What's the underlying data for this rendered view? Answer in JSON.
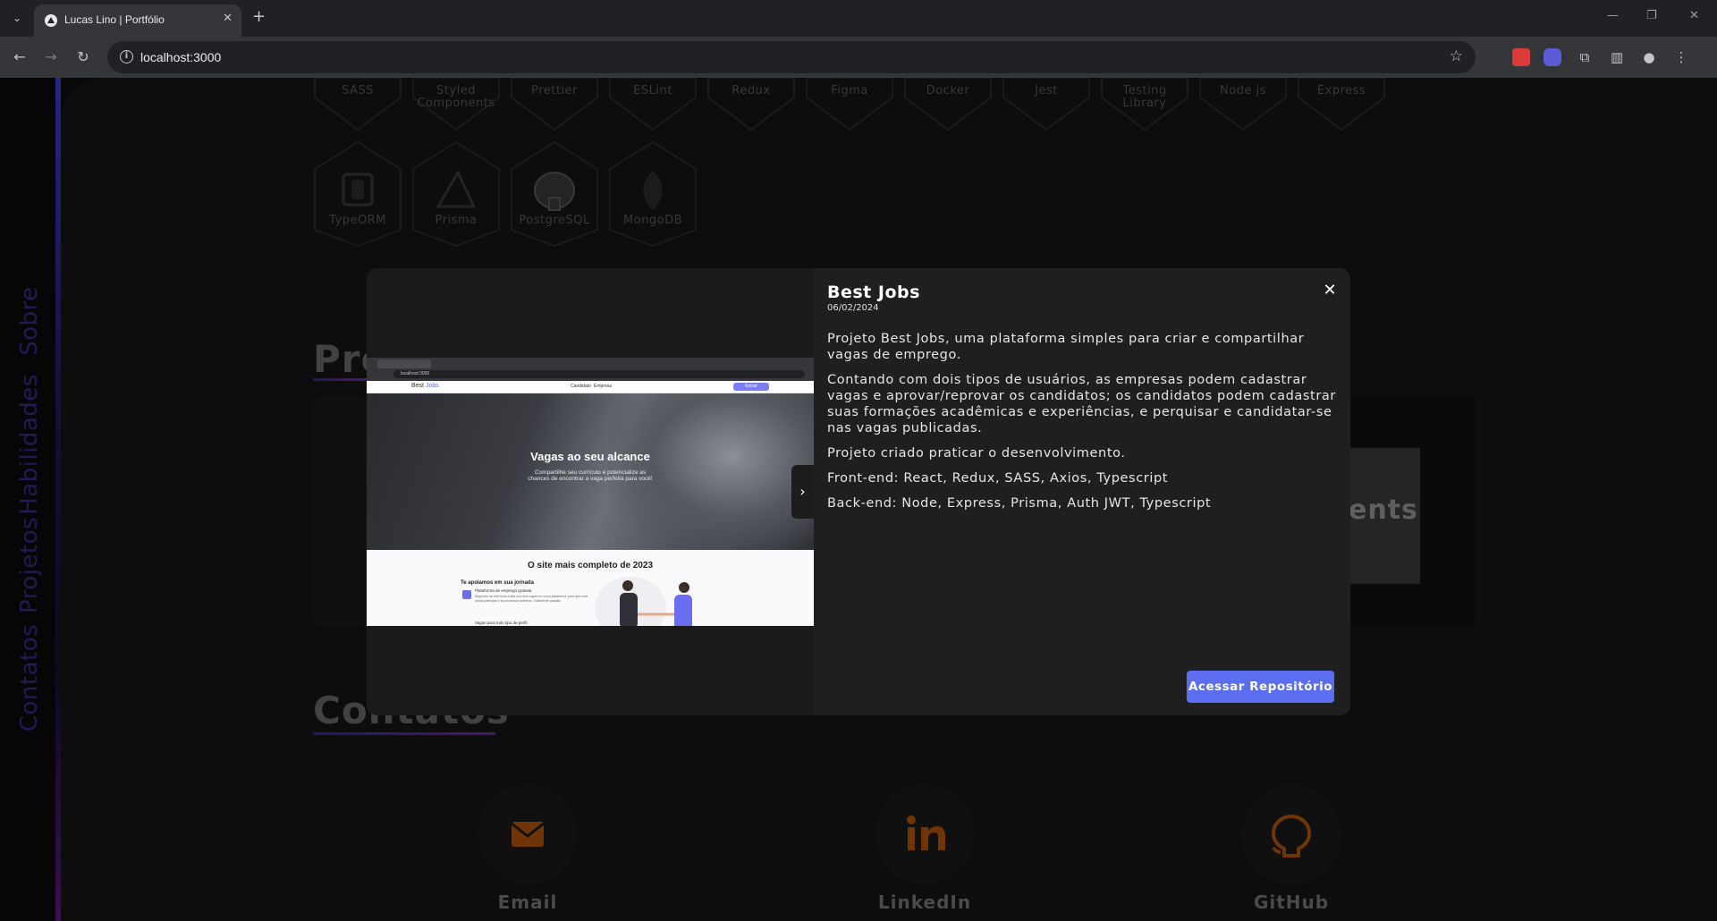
{
  "browser": {
    "tab_title": "Lucas Lino | Portfólio",
    "url": "localhost:3000"
  },
  "side_nav": [
    "Sobre",
    "Habilidades",
    "Projetos",
    "Contatos"
  ],
  "skills_row1": [
    "SASS",
    "Styled Components",
    "Prettier",
    "ESLint",
    "Redux",
    "Figma",
    "Docker",
    "Jest",
    "Testing Library",
    "Node js",
    "Express"
  ],
  "skills_row2": [
    "TypeORM",
    "Prisma",
    "PostgreSQL",
    "MongoDB"
  ],
  "sections": {
    "projects_title_visible": "Pro",
    "projects_card_text": "ents",
    "contacts_title": "Contatos"
  },
  "contacts": [
    {
      "label": "Email",
      "icon": "mail-icon"
    },
    {
      "label": "LinkedIn",
      "icon": "linkedin-icon"
    },
    {
      "label": "GitHub",
      "icon": "github-icon"
    }
  ],
  "modal": {
    "title": "Best Jobs",
    "date": "06/02/2024",
    "paragraphs": [
      "Projeto Best Jobs, uma plataforma simples para criar e compartilhar vagas de emprego.",
      "Contando com dois tipos de usuários, as empresas podem cadastrar vagas e aprovar/reprovar os candidatos; os candidatos podem cadastrar suas formações acadêmicas e experiências, e perquisar e candidatar-se nas vagas publicadas.",
      "Projeto criado praticar o desenvolvimento.",
      "Front-end: React, Redux, SASS, Axios, Typescript",
      "Back-end: Node, Express, Prisma, Auth JWT, Typescript"
    ],
    "button_label": "Acessar Repositório",
    "screenshot": {
      "url": "localhost:3000",
      "logo_text": "Best",
      "logo_accent": "Jobs",
      "nav_links": [
        "Candidato",
        "Empresa"
      ],
      "nav_button": "Entrar",
      "hero_title": "Vagas ao seu alcance",
      "hero_sub": "Compartilhe seu currículo e potencialize as chances de encontrar a vaga perfeita para você!",
      "section_title": "O site mais completo de 2023",
      "feature_title": "Te apoiamos em sua jornada",
      "feature_1": "Plataforma de emprego gratuita",
      "feature_1_desc": "Disponha de todo front a alta com sua vagas em única plataforma, para que você possa participar e as processos seletivos. Totalmente gratuita",
      "feature_2": "Vagas para todo tipo de perfil"
    }
  },
  "colors": {
    "accent": "#5b6ef0",
    "contact_icon": "#e0720f",
    "side_text": "#312c8a"
  }
}
